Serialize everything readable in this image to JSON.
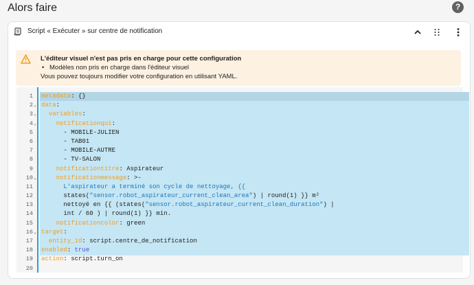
{
  "page": {
    "title": "Alors faire"
  },
  "card": {
    "title": "Script « Exécuter » sur centre de notification"
  },
  "warning": {
    "title": "L'éditeur visuel n'est pas pris en charge pour cette configuration",
    "item": "Modèles non pris en charge dans l'éditeur visuel",
    "note": "Vous pouvez toujours modifier votre configuration en utilisant YAML."
  },
  "icons": {
    "help": "help-circle-icon",
    "script": "script-icon",
    "collapse": "chevron-up-icon",
    "drag": "drag-handle-icon",
    "menu": "dots-vertical-icon",
    "warning": "alert-triangle-icon"
  },
  "colors": {
    "key": "#f29d1b",
    "string": "#1e76b8",
    "bool": "#5a4fd1",
    "selection": "#c5e6f4",
    "gutter_border": "#29a0d8",
    "warning_bg": "#fdf1e2"
  },
  "code": {
    "lines": [
      {
        "n": "1",
        "fold": false,
        "parts": [
          [
            "k",
            "metadata"
          ],
          [
            "p",
            ": {}"
          ]
        ]
      },
      {
        "n": "2",
        "fold": true,
        "parts": [
          [
            "k",
            "data"
          ],
          [
            "p",
            ":"
          ]
        ]
      },
      {
        "n": "3",
        "fold": true,
        "parts": [
          [
            "p",
            "  "
          ],
          [
            "k",
            "variables"
          ],
          [
            "p",
            ":"
          ]
        ]
      },
      {
        "n": "4",
        "fold": true,
        "parts": [
          [
            "p",
            "    "
          ],
          [
            "k",
            "notificationqui"
          ],
          [
            "p",
            ":"
          ]
        ]
      },
      {
        "n": "5",
        "fold": false,
        "parts": [
          [
            "p",
            "      - MOBILE-JULIEN"
          ]
        ]
      },
      {
        "n": "6",
        "fold": false,
        "parts": [
          [
            "p",
            "      - TAB01"
          ]
        ]
      },
      {
        "n": "7",
        "fold": false,
        "parts": [
          [
            "p",
            "      - MOBILE-AUTRE"
          ]
        ]
      },
      {
        "n": "8",
        "fold": false,
        "parts": [
          [
            "p",
            "      - TV-SALON"
          ]
        ]
      },
      {
        "n": "9",
        "fold": false,
        "parts": [
          [
            "p",
            "    "
          ],
          [
            "k",
            "notificationtitre"
          ],
          [
            "p",
            ": Aspirateur"
          ]
        ]
      },
      {
        "n": "10",
        "fold": true,
        "parts": [
          [
            "p",
            "    "
          ],
          [
            "k",
            "notificationmessage"
          ],
          [
            "p",
            ": >-"
          ]
        ]
      },
      {
        "n": "11",
        "fold": false,
        "parts": [
          [
            "s",
            "      L'aspirateur a terminé son cycle de nettoyage, {{"
          ]
        ]
      },
      {
        "n": "12",
        "fold": false,
        "parts": [
          [
            "p",
            "      states("
          ],
          [
            "s",
            "\"sensor.robot_aspirateur_current_clean_area\""
          ],
          [
            "p",
            ") | round(1) }} m²"
          ]
        ]
      },
      {
        "n": "13",
        "fold": false,
        "parts": [
          [
            "p",
            "      nettoyé en {{ (states("
          ],
          [
            "s",
            "\"sensor.robot_aspirateur_current_clean_duration\""
          ],
          [
            "p",
            ") |"
          ]
        ]
      },
      {
        "n": "14",
        "fold": false,
        "parts": [
          [
            "p",
            "      int / 60 ) | round(1) }} min."
          ]
        ]
      },
      {
        "n": "15",
        "fold": false,
        "parts": [
          [
            "p",
            "    "
          ],
          [
            "k",
            "notificationcolor"
          ],
          [
            "p",
            ": green"
          ]
        ]
      },
      {
        "n": "16",
        "fold": true,
        "parts": [
          [
            "k",
            "target"
          ],
          [
            "p",
            ":"
          ]
        ]
      },
      {
        "n": "17",
        "fold": false,
        "parts": [
          [
            "p",
            "  "
          ],
          [
            "k",
            "entity_id"
          ],
          [
            "p",
            ": script.centre_de_notification"
          ]
        ]
      },
      {
        "n": "18",
        "fold": false,
        "parts": [
          [
            "k",
            "enabled"
          ],
          [
            "p",
            ": "
          ],
          [
            "b",
            "true"
          ]
        ]
      },
      {
        "n": "19",
        "fold": false,
        "parts": [
          [
            "k",
            "action"
          ],
          [
            "p",
            ": script.turn_on"
          ]
        ]
      },
      {
        "n": "20",
        "fold": false,
        "parts": []
      }
    ]
  }
}
